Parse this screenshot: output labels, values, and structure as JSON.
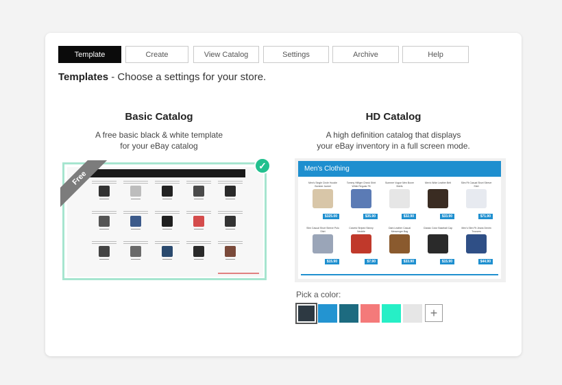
{
  "tabs": [
    {
      "label": "Template",
      "active": true
    },
    {
      "label": "Create",
      "active": false
    },
    {
      "label": "View Catalog",
      "active": false
    },
    {
      "label": "Settings",
      "active": false
    },
    {
      "label": "Archive",
      "active": false
    },
    {
      "label": "Help",
      "active": false
    }
  ],
  "heading": {
    "title": "Templates",
    "subtitle": " - Choose a settings for your store."
  },
  "basic": {
    "title": "Basic Catalog",
    "desc_line1": "A free basic black & white template",
    "desc_line2": "for your eBay catalog",
    "ribbon": "Free"
  },
  "hd": {
    "title": "HD Catalog",
    "desc_line1": "A high definition catalog that displays",
    "desc_line2": "your eBay inventory in a full screen mode.",
    "banner": "Men's Clothing",
    "products": [
      {
        "title": "Men's Single Circle Hoodie Bomber Jacket",
        "price": "$325.00",
        "color": "#d8c6a8"
      },
      {
        "title": "Tommy Hilfiger Check Shirt White Regular Fit",
        "price": "$35.90",
        "color": "#5b7bb5"
      },
      {
        "title": "Summer Vogue Men Boxer Briefs",
        "price": "$32.90",
        "color": "#e6e6e6"
      },
      {
        "title": "Men's Wide Leather Belt",
        "price": "$33.90",
        "color": "#3a2c22"
      },
      {
        "title": "Slim Fit Casual Short Sleeve Shirt",
        "price": "$71.90",
        "color": "#e7eaf0"
      },
      {
        "title": "Slim Casual Short Sleeve Polo Shirt",
        "price": "$15.90",
        "color": "#9aa5b8"
      },
      {
        "title": "Colorful Striped Skinny Necktie",
        "price": "$7.90",
        "color": "#c0392b"
      },
      {
        "title": "Dark Leather Casual Messenger Bag",
        "price": "$33.90",
        "color": "#8a5a2e"
      },
      {
        "title": "Classic Color Baseball Cap",
        "price": "$15.90",
        "color": "#2a2a2a"
      },
      {
        "title": "Men's Slim Fit Jeans Denim Trousers",
        "price": "$44.90",
        "color": "#2f4f86"
      }
    ]
  },
  "basic_products": [
    {
      "price": "$ 299.00",
      "color": "#333333"
    },
    {
      "price": "$ 299.00",
      "color": "#bdbdbd"
    },
    {
      "price": "$ 299.00",
      "color": "#222222"
    },
    {
      "price": "$ 299.00",
      "color": "#4a4a4a"
    },
    {
      "price": "$ 299.00",
      "color": "#2a2a2a"
    },
    {
      "price": "$ 299.00",
      "color": "#555555"
    },
    {
      "price": "$ 299.00",
      "color": "#3c5a8a"
    },
    {
      "price": "$ 299.00",
      "color": "#1f1f1f"
    },
    {
      "price": "$ 299.00",
      "color": "#d44c4c"
    },
    {
      "price": "$ 299.00",
      "color": "#333333"
    },
    {
      "price": "$ 299.00",
      "color": "#444444"
    },
    {
      "price": "$ 299.00",
      "color": "#6a6a6a"
    },
    {
      "price": "$ 299.00",
      "color": "#2b4a6e"
    },
    {
      "price": "$ 299.00",
      "color": "#2a2a2a"
    },
    {
      "price": "$ 299.00",
      "color": "#7a4a3a"
    }
  ],
  "pick_color": {
    "label": "Pick a color:",
    "colors": [
      "#2d3942",
      "#2394d1",
      "#1d6b80",
      "#f47a7a",
      "#26efc6",
      "#e6e6e6"
    ],
    "selected_index": 0,
    "add_label": "+"
  }
}
